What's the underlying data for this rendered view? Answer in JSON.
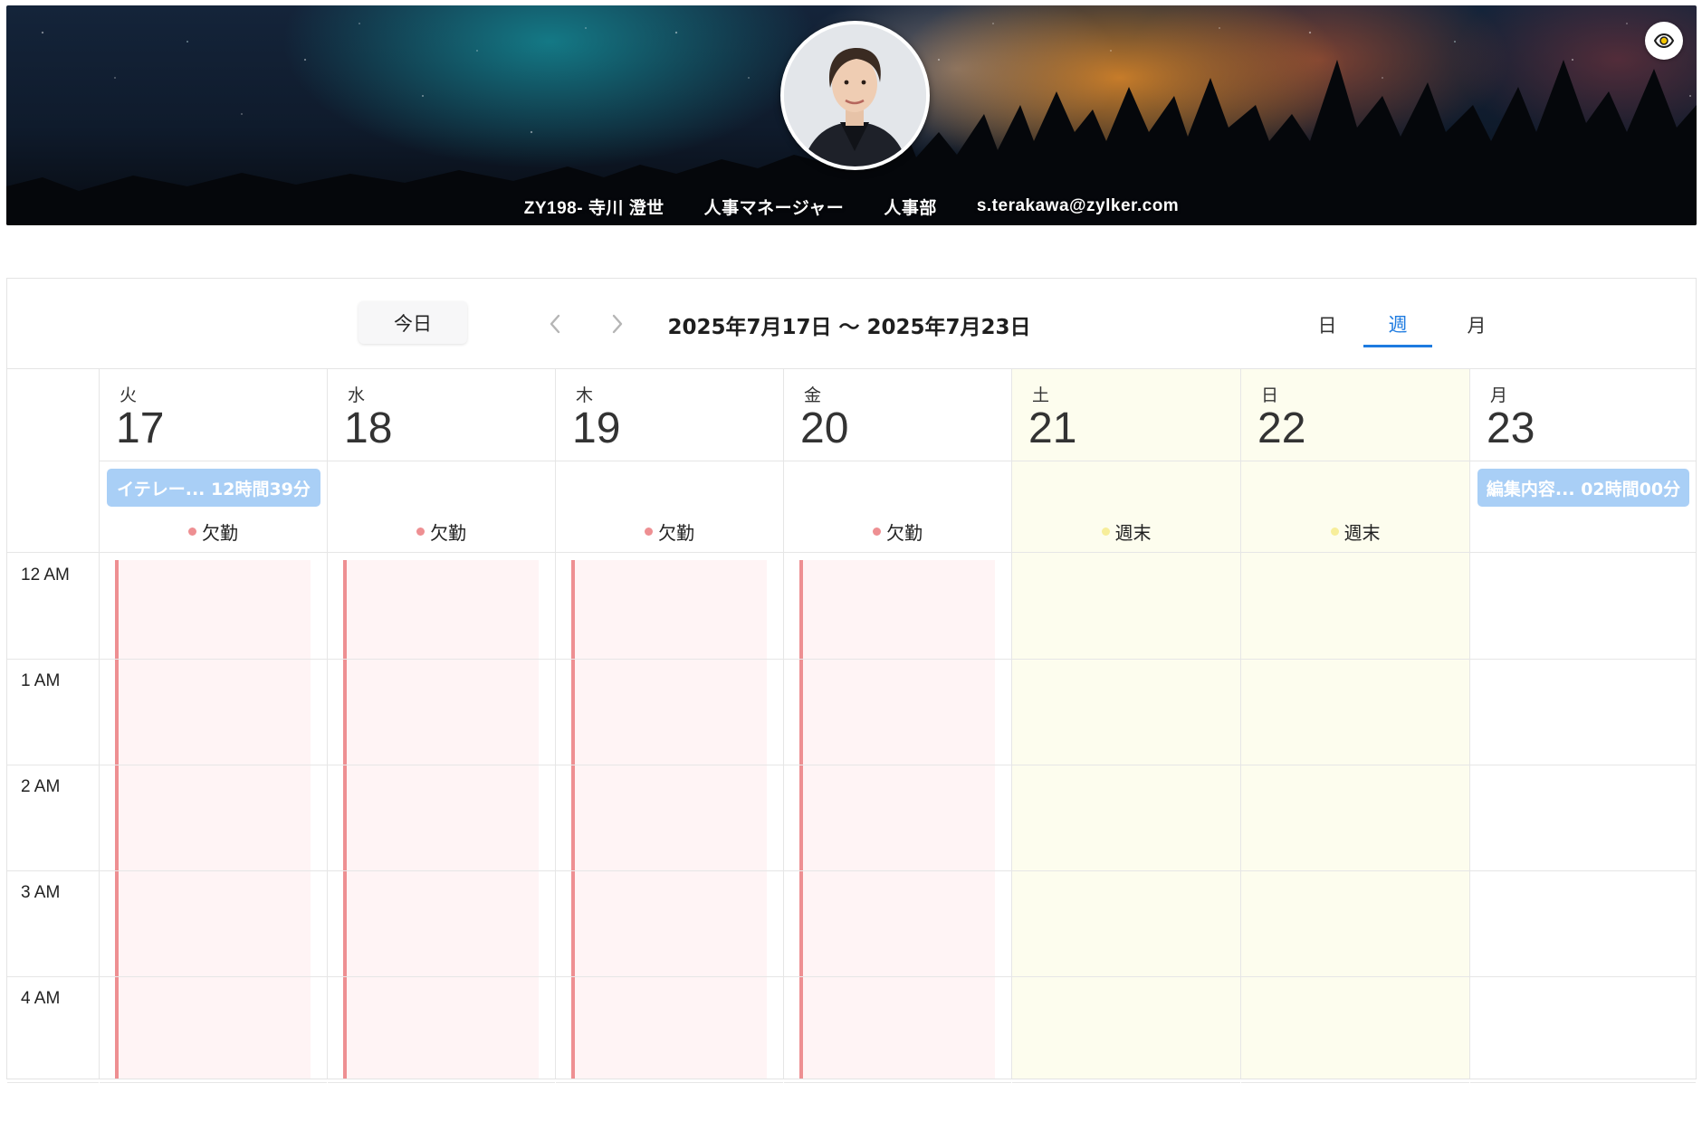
{
  "profile": {
    "employee_id_name": "ZY198- 寺川 澄世",
    "title": "人事マネージャー",
    "department": "人事部",
    "email": "s.terakawa@zylker.com"
  },
  "toolbar": {
    "today_label": "今日",
    "date_range": "2025年7月17日 〜 2025年7月23日",
    "views": {
      "day": "日",
      "week": "週",
      "month": "月"
    },
    "active_view": "week"
  },
  "days": [
    {
      "weekday": "火",
      "date": "17",
      "status": "欠勤",
      "event": "イテレー... 12時間39分"
    },
    {
      "weekday": "水",
      "date": "18",
      "status": "欠勤"
    },
    {
      "weekday": "木",
      "date": "19",
      "status": "欠勤"
    },
    {
      "weekday": "金",
      "date": "20",
      "status": "欠勤"
    },
    {
      "weekday": "土",
      "date": "21",
      "status": "週末"
    },
    {
      "weekday": "日",
      "date": "22",
      "status": "週末"
    },
    {
      "weekday": "月",
      "date": "23",
      "event": "編集内容... 02時間00分"
    }
  ],
  "hours": [
    "12 AM",
    "1 AM",
    "2 AM",
    "3 AM",
    "4 AM"
  ],
  "colors": {
    "accent": "#1e7be0",
    "absence": "#ee8f92",
    "absence_bg": "#fff4f5",
    "weekend": "#fdfdee",
    "weekend_dot": "#f7ee9a",
    "event_chip": "#a9cff6"
  }
}
